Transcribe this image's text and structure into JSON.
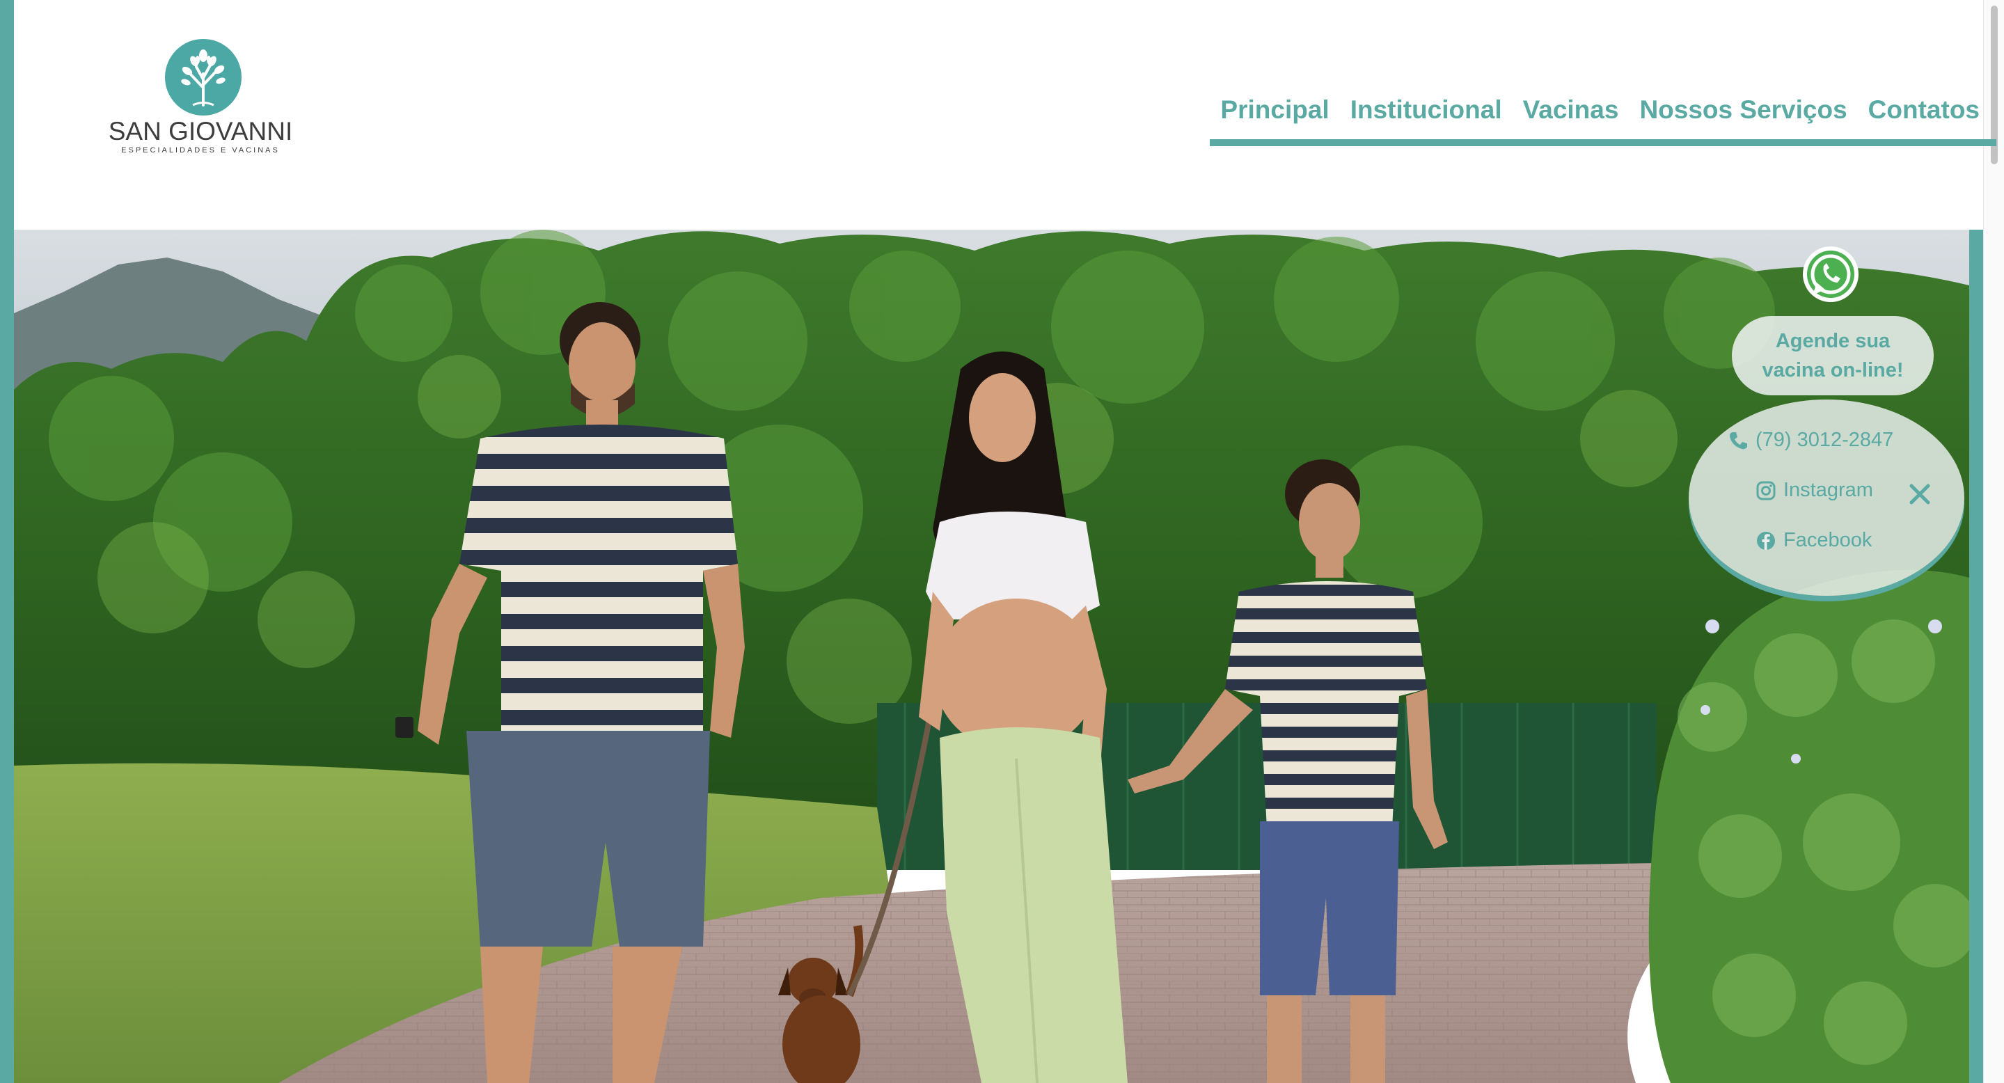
{
  "brand": {
    "name": "SAN GIOVANNI",
    "tagline": "ESPECIALIDADES E VACINAS",
    "color": "#5aa9a3"
  },
  "nav": {
    "items": [
      "Principal",
      "Institucional",
      "Vacinas",
      "Nossos Serviços",
      "Contatos"
    ]
  },
  "widget": {
    "whatsapp_icon": "whatsapp-icon",
    "cta": "Agende sua vacina on-line!",
    "phone": "(79) 3012-2847",
    "instagram": "Instagram",
    "facebook": "Facebook",
    "close_icon": "close-icon"
  },
  "hero": {
    "image": "family-walking-park-photo"
  }
}
